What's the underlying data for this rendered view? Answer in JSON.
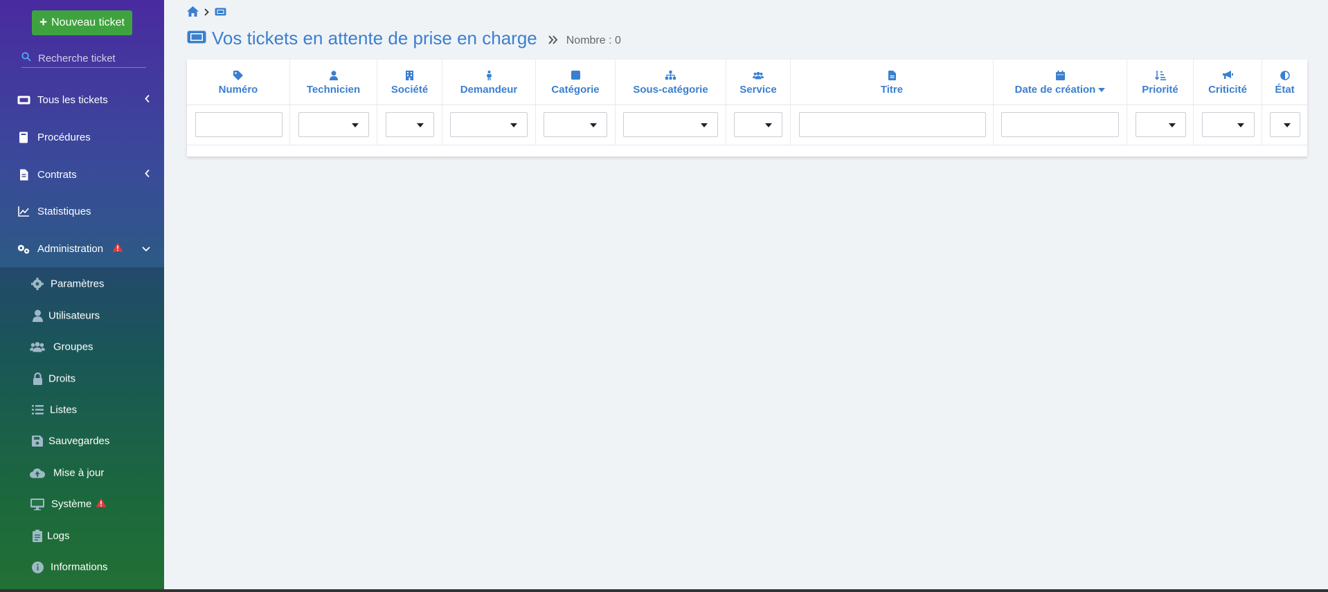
{
  "sidebar": {
    "new_ticket_label": "Nouveau ticket",
    "search_placeholder": "Recherche ticket",
    "items": [
      {
        "label": "Tous les tickets",
        "icon": "ticket-icon",
        "chevron": "left"
      },
      {
        "label": "Procédures",
        "icon": "book-icon"
      },
      {
        "label": "Contrats",
        "icon": "contract-icon",
        "chevron": "left"
      },
      {
        "label": "Statistiques",
        "icon": "chart-line-icon"
      },
      {
        "label": "Administration",
        "icon": "cogs-icon",
        "chevron": "down",
        "warning": true
      }
    ],
    "subitems": [
      {
        "label": "Paramètres",
        "icon": "gear-icon"
      },
      {
        "label": "Utilisateurs",
        "icon": "user-icon"
      },
      {
        "label": "Groupes",
        "icon": "users-icon"
      },
      {
        "label": "Droits",
        "icon": "lock-icon"
      },
      {
        "label": "Listes",
        "icon": "list-icon"
      },
      {
        "label": "Sauvegardes",
        "icon": "save-icon"
      },
      {
        "label": "Mise à jour",
        "icon": "cloud-upload-icon"
      },
      {
        "label": "Système",
        "icon": "desktop-icon",
        "warning": true
      },
      {
        "label": "Logs",
        "icon": "clipboard-icon"
      },
      {
        "label": "Informations",
        "icon": "info-icon"
      }
    ]
  },
  "main": {
    "title": "Vos tickets en attente de prise en charge",
    "count_label": "Nombre : 0",
    "columns": [
      {
        "label": "Numéro",
        "icon": "tag-icon",
        "filter": "input"
      },
      {
        "label": "Technicien",
        "icon": "user-icon",
        "filter": "select"
      },
      {
        "label": "Société",
        "icon": "building-icon",
        "filter": "select"
      },
      {
        "label": "Demandeur",
        "icon": "person-icon",
        "filter": "select"
      },
      {
        "label": "Catégorie",
        "icon": "square-icon",
        "filter": "select"
      },
      {
        "label": "Sous-catégorie",
        "icon": "sitemap-icon",
        "filter": "select"
      },
      {
        "label": "Service",
        "icon": "users-icon",
        "filter": "select"
      },
      {
        "label": "Titre",
        "icon": "file-icon",
        "filter": "input"
      },
      {
        "label": "Date de création",
        "icon": "calendar-icon",
        "filter": "input",
        "sorted": "desc"
      },
      {
        "label": "Priorité",
        "icon": "sort-amount-icon",
        "filter": "select"
      },
      {
        "label": "Criticité",
        "icon": "bullhorn-icon",
        "filter": "select"
      },
      {
        "label": "État",
        "icon": "adjust-icon",
        "filter": "select"
      }
    ]
  },
  "colors": {
    "accent": "#3a7fd0",
    "button_green": "#3ea33e",
    "warning_red": "#e03b3b"
  }
}
